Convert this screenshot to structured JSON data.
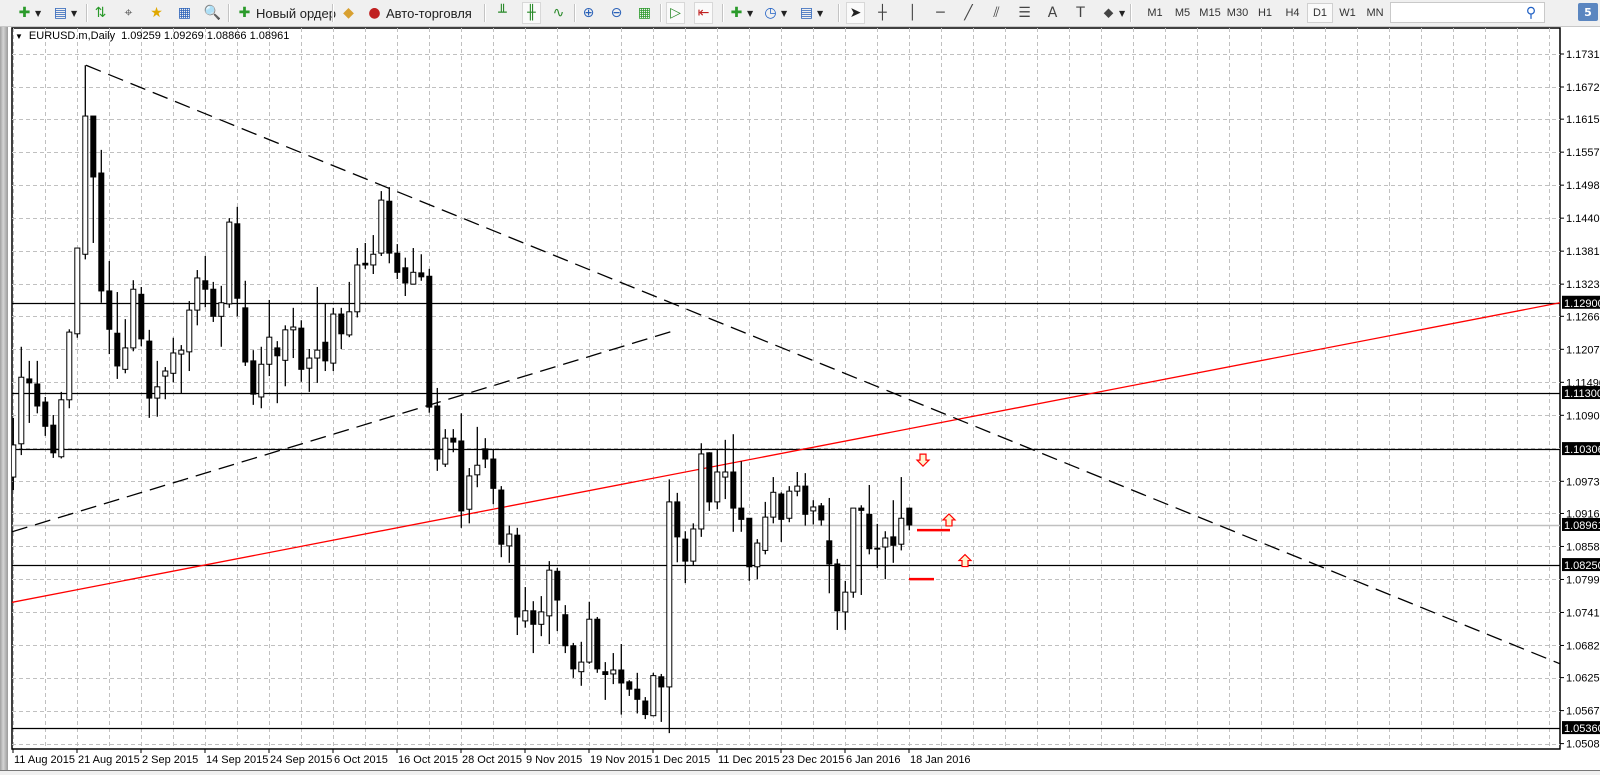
{
  "toolbar": {
    "buttons": [
      {
        "icon": "new-chart-icon",
        "glyph": "✚",
        "color": "#2a9a2a",
        "dropdown": true
      },
      {
        "icon": "profiles-icon",
        "glyph": "▤",
        "color": "#2b62b8",
        "dropdown": true
      },
      {
        "icon": "market-watch-icon",
        "glyph": "⇅",
        "color": "#2a9a2a"
      },
      {
        "icon": "crosshair-data-window-icon",
        "glyph": "⌖",
        "color": "#555"
      },
      {
        "icon": "navigator-icon",
        "glyph": "★",
        "color": "#e0a800"
      },
      {
        "icon": "terminal-icon",
        "glyph": "▦",
        "color": "#2b62b8"
      },
      {
        "icon": "strategy-tester-icon",
        "glyph": "🔍",
        "color": "#2b62b8"
      },
      {
        "icon": "new-order-icon",
        "glyph": "✚",
        "color": "#2a9a2a",
        "label": "Новый ордер"
      },
      {
        "icon": "metaeditor-icon",
        "glyph": "◆",
        "color": "#d8a030"
      },
      {
        "icon": "auto-trading-icon",
        "glyph": "●",
        "color": "#c02020",
        "label": "Авто-торговля"
      },
      {
        "icon": "bar-chart-icon",
        "glyph": "╨",
        "color": "#2a8a2a"
      },
      {
        "icon": "candlestick-chart-icon",
        "glyph": "╫",
        "color": "#2a8a2a",
        "pressed": true
      },
      {
        "icon": "line-chart-icon",
        "glyph": "∿",
        "color": "#2a8a2a"
      },
      {
        "icon": "zoom-in-icon",
        "glyph": "⊕",
        "color": "#2b62b8"
      },
      {
        "icon": "zoom-out-icon",
        "glyph": "⊖",
        "color": "#2b62b8"
      },
      {
        "icon": "tile-windows-icon",
        "glyph": "▦",
        "color": "#2a9a2a"
      },
      {
        "icon": "auto-scroll-icon",
        "glyph": "▷",
        "color": "#2a8a2a",
        "pressed": true
      },
      {
        "icon": "chart-shift-icon",
        "glyph": "⇤",
        "color": "#c02020",
        "pressed": true
      },
      {
        "icon": "indicators-icon",
        "glyph": "✚",
        "color": "#2a9a2a",
        "dropdown": true
      },
      {
        "icon": "periods-clock-icon",
        "glyph": "◷",
        "color": "#1e5fc4",
        "dropdown": true
      },
      {
        "icon": "templates-icon",
        "glyph": "▤",
        "color": "#2b62b8",
        "dropdown": true
      },
      {
        "icon": "cursor-icon",
        "glyph": "➤",
        "color": "#222",
        "pressed": true
      },
      {
        "icon": "crosshair-icon",
        "glyph": "┼",
        "color": "#444"
      },
      {
        "icon": "vertical-line-icon",
        "glyph": "│",
        "color": "#444"
      },
      {
        "icon": "horizontal-line-icon",
        "glyph": "─",
        "color": "#444"
      },
      {
        "icon": "trendline-icon",
        "glyph": "╱",
        "color": "#444"
      },
      {
        "icon": "equidistant-channel-icon",
        "glyph": "⫽",
        "color": "#444"
      },
      {
        "icon": "fibonacci-icon",
        "glyph": "☰",
        "color": "#444"
      },
      {
        "icon": "text-icon",
        "glyph": "A",
        "color": "#444"
      },
      {
        "icon": "text-label-icon",
        "glyph": "T",
        "color": "#444"
      },
      {
        "icon": "arrows-shapes-icon",
        "glyph": "⬥",
        "color": "#444",
        "dropdown": true
      }
    ],
    "timeframes": [
      "M1",
      "M5",
      "M15",
      "M30",
      "H1",
      "H4",
      "D1",
      "W1",
      "MN"
    ],
    "active_timeframe": "D1",
    "search_placeholder": "",
    "chat_badge": "5"
  },
  "chart_header": {
    "symbol": "EURUSD.m,Daily",
    "ohlc": "1.09259 1.09269 1.08866 1.08961"
  },
  "chart_data": {
    "type": "candlestick",
    "symbol": "EURUSD.m",
    "timeframe": "Daily",
    "date_labels": [
      "11 Aug 2015",
      "21 Aug 2015",
      "2 Sep 2015",
      "14 Sep 2015",
      "24 Sep 2015",
      "6 Oct 2015",
      "16 Oct 2015",
      "28 Oct 2015",
      "9 Nov 2015",
      "19 Nov 2015",
      "1 Dec 2015",
      "11 Dec 2015",
      "23 Dec 2015",
      "6 Jan 2016",
      "18 Jan 2016"
    ],
    "price_ticks": [
      "1.17310",
      "1.16725",
      "1.16155",
      "1.15570",
      "1.14985",
      "1.14400",
      "1.13815",
      "1.13230",
      "1.12660",
      "1.12075",
      "1.11490",
      "1.10905",
      "1.09735",
      "1.09165",
      "1.08580",
      "1.07995",
      "1.07410",
      "1.06825",
      "1.06255",
      "1.05670",
      "1.05085"
    ],
    "ylim": [
      1.05085,
      1.1731
    ],
    "grid": true,
    "bull_color": "#ffffff",
    "bear_color": "#000000",
    "candles_ohlc": [
      [
        1.0981,
        1.1086,
        1.0958,
        1.1038
      ],
      [
        1.104,
        1.1212,
        1.102,
        1.1158
      ],
      [
        1.1155,
        1.1187,
        1.1077,
        1.1148
      ],
      [
        1.1146,
        1.1187,
        1.1094,
        1.1107
      ],
      [
        1.1114,
        1.1123,
        1.1054,
        1.1071
      ],
      [
        1.1073,
        1.1091,
        1.1015,
        1.1024
      ],
      [
        1.1017,
        1.1132,
        1.1014,
        1.1118
      ],
      [
        1.1118,
        1.1243,
        1.1103,
        1.1238
      ],
      [
        1.1235,
        1.1387,
        1.1228,
        1.1387
      ],
      [
        1.1376,
        1.1711,
        1.1367,
        1.1621
      ],
      [
        1.1621,
        1.1621,
        1.1396,
        1.1513
      ],
      [
        1.152,
        1.1561,
        1.129,
        1.1311
      ],
      [
        1.1311,
        1.1364,
        1.1199,
        1.1243
      ],
      [
        1.1236,
        1.1309,
        1.1155,
        1.1178
      ],
      [
        1.1172,
        1.1261,
        1.1165,
        1.121
      ],
      [
        1.121,
        1.133,
        1.1204,
        1.1314
      ],
      [
        1.1305,
        1.1318,
        1.1213,
        1.1226
      ],
      [
        1.1222,
        1.1242,
        1.1086,
        1.1121
      ],
      [
        1.1121,
        1.1187,
        1.1088,
        1.1141
      ],
      [
        1.116,
        1.1176,
        1.1119,
        1.1169
      ],
      [
        1.1165,
        1.1228,
        1.1149,
        1.1201
      ],
      [
        1.1199,
        1.1215,
        1.113,
        1.1206
      ],
      [
        1.1203,
        1.1293,
        1.1169,
        1.1277
      ],
      [
        1.1277,
        1.1348,
        1.125,
        1.1334
      ],
      [
        1.1329,
        1.1373,
        1.1282,
        1.1314
      ],
      [
        1.1314,
        1.1327,
        1.1256,
        1.1266
      ],
      [
        1.1266,
        1.132,
        1.1212,
        1.129
      ],
      [
        1.1288,
        1.144,
        1.1281,
        1.1433
      ],
      [
        1.143,
        1.146,
        1.1266,
        1.1298
      ],
      [
        1.1281,
        1.1329,
        1.1178,
        1.1185
      ],
      [
        1.1187,
        1.1206,
        1.1109,
        1.1128
      ],
      [
        1.1123,
        1.1212,
        1.1103,
        1.1181
      ],
      [
        1.1181,
        1.1295,
        1.116,
        1.1229
      ],
      [
        1.121,
        1.1222,
        1.1112,
        1.1196
      ],
      [
        1.1188,
        1.125,
        1.1142,
        1.1242
      ],
      [
        1.1242,
        1.1281,
        1.1192,
        1.1247
      ],
      [
        1.1245,
        1.1259,
        1.115,
        1.1172
      ],
      [
        1.1174,
        1.1208,
        1.1132,
        1.1192
      ],
      [
        1.1192,
        1.1318,
        1.1148,
        1.1206
      ],
      [
        1.122,
        1.1288,
        1.1169,
        1.1187
      ],
      [
        1.1183,
        1.1281,
        1.1169,
        1.127
      ],
      [
        1.127,
        1.1281,
        1.1208,
        1.1235
      ],
      [
        1.1233,
        1.1327,
        1.1229,
        1.1274
      ],
      [
        1.1274,
        1.1387,
        1.1264,
        1.1357
      ],
      [
        1.136,
        1.1396,
        1.135,
        1.1357
      ],
      [
        1.1357,
        1.141,
        1.1341,
        1.1376
      ],
      [
        1.1378,
        1.1488,
        1.1373,
        1.1472
      ],
      [
        1.147,
        1.1495,
        1.136,
        1.1378
      ],
      [
        1.1378,
        1.1394,
        1.1332,
        1.1344
      ],
      [
        1.1352,
        1.137,
        1.1302,
        1.1325
      ],
      [
        1.1323,
        1.1387,
        1.1323,
        1.1344
      ],
      [
        1.1343,
        1.1376,
        1.1329,
        1.1336
      ],
      [
        1.1337,
        1.135,
        1.1095,
        1.1105
      ],
      [
        1.1107,
        1.1139,
        1.0992,
        1.1013
      ],
      [
        1.1004,
        1.1066,
        1.0999,
        1.105
      ],
      [
        1.105,
        1.1066,
        1.1025,
        1.1043
      ],
      [
        1.1045,
        1.1094,
        1.0891,
        1.0921
      ],
      [
        1.0924,
        1.0997,
        1.0899,
        1.0983
      ],
      [
        1.0985,
        1.107,
        1.0963,
        1.1002
      ],
      [
        1.1031,
        1.105,
        1.0997,
        1.1013
      ],
      [
        1.1013,
        1.1029,
        1.0933,
        1.0961
      ],
      [
        1.0958,
        1.0965,
        1.0839,
        1.0862
      ],
      [
        1.0859,
        1.0895,
        1.0829,
        1.088
      ],
      [
        1.0878,
        1.0891,
        1.0701,
        1.0733
      ],
      [
        1.0726,
        1.0786,
        1.0714,
        1.0744
      ],
      [
        1.0744,
        1.0761,
        1.0669,
        1.072
      ],
      [
        1.072,
        1.077,
        1.0699,
        1.0742
      ],
      [
        1.0735,
        1.0832,
        1.0685,
        1.0816
      ],
      [
        1.0814,
        1.082,
        1.0708,
        1.0763
      ],
      [
        1.0737,
        1.0754,
        1.0669,
        1.0682
      ],
      [
        1.0682,
        1.0687,
        1.0625,
        1.0641
      ],
      [
        1.0636,
        1.0689,
        1.0611,
        1.0653
      ],
      [
        1.0653,
        1.076,
        1.065,
        1.0729
      ],
      [
        1.0729,
        1.0733,
        1.0634,
        1.0641
      ],
      [
        1.0636,
        1.0653,
        1.0586,
        1.0631
      ],
      [
        1.0632,
        1.0669,
        1.0614,
        1.0639
      ],
      [
        1.0639,
        1.0685,
        1.056,
        1.0616
      ],
      [
        1.0618,
        1.0621,
        1.0593,
        1.0605
      ],
      [
        1.0605,
        1.0634,
        1.0562,
        1.0587
      ],
      [
        1.0584,
        1.0591,
        1.0552,
        1.056
      ],
      [
        1.0558,
        1.0634,
        1.0557,
        1.0629
      ],
      [
        1.0627,
        1.0632,
        1.0547,
        1.0609
      ],
      [
        1.0609,
        1.0977,
        1.0527,
        1.0937
      ],
      [
        1.0937,
        1.0953,
        1.083,
        1.0875
      ],
      [
        1.0871,
        1.0885,
        1.0793,
        1.0832
      ],
      [
        1.0832,
        1.0899,
        1.0825,
        1.0889
      ],
      [
        1.0889,
        1.1041,
        1.0875,
        1.1022
      ],
      [
        1.1024,
        1.1025,
        1.0921,
        1.0937
      ],
      [
        1.0937,
        1.1029,
        1.0924,
        1.099
      ],
      [
        1.0981,
        1.1047,
        1.0942,
        1.099
      ],
      [
        1.099,
        1.1057,
        1.0884,
        1.0926
      ],
      [
        1.0926,
        1.1009,
        1.0884,
        1.0906
      ],
      [
        1.0908,
        1.0908,
        1.0797,
        1.0822
      ],
      [
        1.0822,
        1.0871,
        1.08,
        1.0864
      ],
      [
        1.0851,
        1.0937,
        1.0844,
        1.091
      ],
      [
        1.091,
        1.0981,
        1.0899,
        1.0954
      ],
      [
        1.0951,
        1.0954,
        1.0866,
        1.0906
      ],
      [
        1.0908,
        1.0965,
        1.0901,
        1.0956
      ],
      [
        1.0956,
        1.099,
        1.0947,
        1.0965
      ],
      [
        1.0965,
        1.0988,
        1.0895,
        1.0915
      ],
      [
        1.0921,
        1.094,
        1.0897,
        1.0928
      ],
      [
        1.093,
        1.0935,
        1.0895,
        1.0905
      ],
      [
        1.0868,
        1.0944,
        1.0775,
        1.0827
      ],
      [
        1.0827,
        1.0836,
        1.071,
        1.0744
      ],
      [
        1.0742,
        1.0797,
        1.071,
        1.0777
      ],
      [
        1.0777,
        1.0926,
        1.0767,
        1.0926
      ],
      [
        1.0926,
        1.0931,
        1.0772,
        1.0922
      ],
      [
        1.0915,
        1.0967,
        1.0844,
        1.0854
      ],
      [
        1.0855,
        1.0898,
        1.082,
        1.0854
      ],
      [
        1.0857,
        1.0885,
        1.08,
        1.0873
      ],
      [
        1.0875,
        1.094,
        1.0829,
        1.086
      ],
      [
        1.0862,
        1.0981,
        1.0851,
        1.0908
      ],
      [
        1.09259,
        1.09269,
        1.08866,
        1.08961
      ]
    ],
    "horizontal_lines": [
      {
        "price": 1.129,
        "label": "1.12900",
        "color": "#000000"
      },
      {
        "price": 1.113,
        "label": "1.11300",
        "color": "#000000"
      },
      {
        "price": 1.10306,
        "label": "1.10306",
        "color": "#000000"
      },
      {
        "price": 1.0825,
        "label": "1.08250",
        "color": "#000000"
      },
      {
        "price": 1.0536,
        "label": "1.05360",
        "color": "#000000"
      }
    ],
    "bid_line": {
      "price": 1.08961,
      "label": "1.08961",
      "color": "#c0c0c0"
    },
    "trendlines": [
      {
        "name": "red-trendline",
        "start_price": 1.0759,
        "end_price": 1.129,
        "color": "#ff0000",
        "dashed": false
      },
      {
        "name": "resistance-trendline",
        "start_price": 1.1711,
        "end_price": 1.065,
        "color": "#000000",
        "dashed": true
      },
      {
        "name": "support-trendline",
        "start_price": 1.0884,
        "end_price": 1.1242,
        "color": "#000000",
        "dashed": true
      }
    ],
    "markers": [
      {
        "type": "down-arrow",
        "price": 1.1011,
        "color": "#ff0000"
      },
      {
        "type": "up-arrow",
        "price": 1.0905,
        "color": "#ff0000"
      },
      {
        "type": "up-arrow",
        "price": 1.0833,
        "color": "#ff0000"
      },
      {
        "type": "level-segment",
        "price": 1.0887,
        "color": "#ff0000"
      },
      {
        "type": "level-segment",
        "price": 1.08,
        "color": "#ff0000"
      }
    ]
  }
}
